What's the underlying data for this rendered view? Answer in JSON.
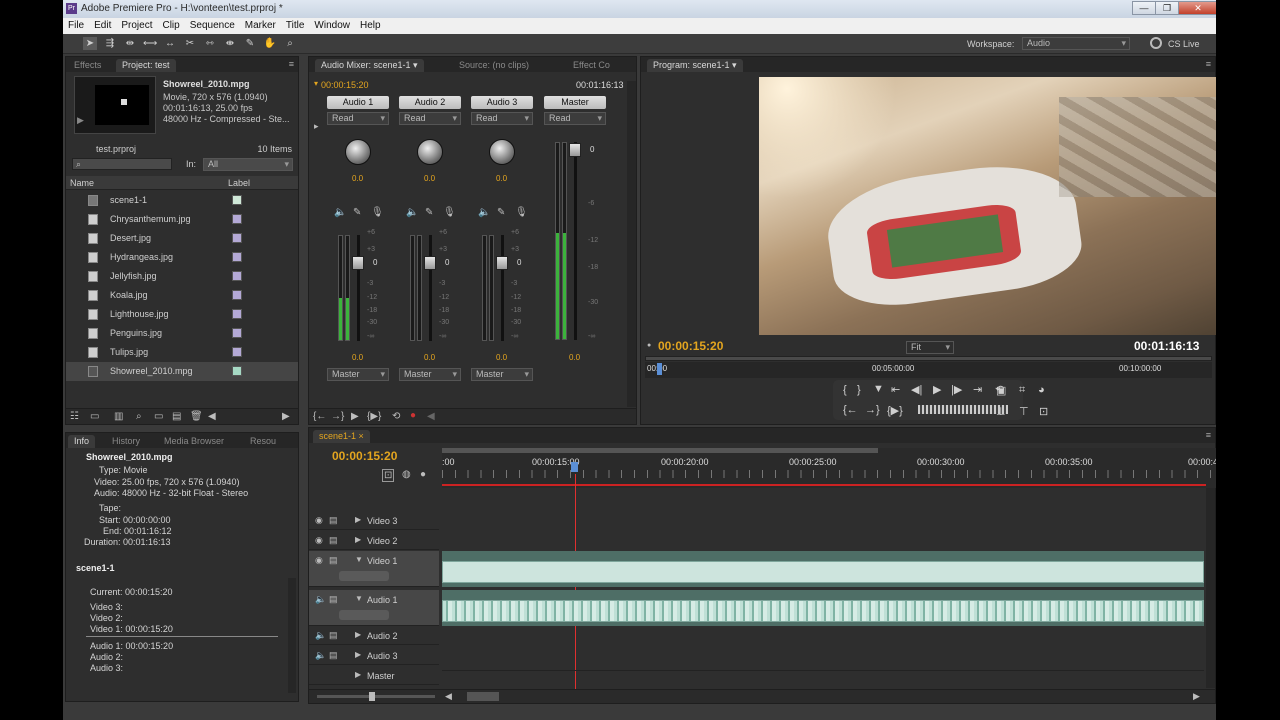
{
  "window": {
    "title": "Adobe Premiere Pro - H:\\vonteen\\test.prproj *",
    "min": "—",
    "max": "❐",
    "close": "✕"
  },
  "menu": [
    "File",
    "Edit",
    "Project",
    "Clip",
    "Sequence",
    "Marker",
    "Title",
    "Window",
    "Help"
  ],
  "workspace": {
    "label": "Workspace:",
    "value": "Audio",
    "cslive": "CS Live"
  },
  "project": {
    "tabs": [
      "Effects",
      "Project: test"
    ],
    "clip_name": "Showreel_2010.mpg",
    "clip_info": [
      "Movie, 720 x 576 (1.0940)",
      "00:01:16:13, 25.00 fps",
      "48000 Hz - Compressed - Ste..."
    ],
    "proj_name": "test.prproj",
    "item_count": "10 Items",
    "in_label": "In:",
    "in_value": "All",
    "col_name": "Name",
    "col_label": "Label",
    "items": [
      "scene1-1",
      "Chrysanthemum.jpg",
      "Desert.jpg",
      "Hydrangeas.jpg",
      "Jellyfish.jpg",
      "Koala.jpg",
      "Lighthouse.jpg",
      "Penguins.jpg",
      "Tulips.jpg",
      "Showreel_2010.mpg"
    ]
  },
  "mixer": {
    "tabs": [
      "Audio Mixer: scene1-1",
      "Source: (no clips)",
      "Effect Co"
    ],
    "time_left": "00:00:15:20",
    "time_right": "00:01:16:13",
    "channels": [
      "Audio 1",
      "Audio 2",
      "Audio 3",
      "Master"
    ],
    "mode": "Read",
    "knob_value": "0.0",
    "fader_value": "0.0",
    "fader_top": "0",
    "output": "Master",
    "scale": [
      "+6",
      "+3",
      "0",
      "-3",
      "-6",
      "-12",
      "-18",
      "-30",
      "-∞"
    ],
    "master_scale": [
      "0",
      "-6",
      "-12",
      "-18",
      "-30",
      "-∞"
    ]
  },
  "program": {
    "tab": "Program: scene1-1",
    "time": "00:00:15:20",
    "duration": "00:01:16:13",
    "fit": "Fit",
    "ruler": [
      "00:00",
      "00:05:00:00",
      "00:10:00:00"
    ]
  },
  "info": {
    "tabs": [
      "Info",
      "History",
      "Media Browser",
      "Resou"
    ],
    "clip": "Showreel_2010.mpg",
    "lines": [
      "Type: Movie",
      "Video: 25.00 fps, 720 x 576 (1.0940)",
      "Audio: 48000 Hz - 32-bit Float - Stereo",
      "",
      "Tape:",
      "Start: 00:00:00:00",
      "End: 00:01:16:12",
      "Duration: 00:01:16:13"
    ],
    "seq": "scene1-1",
    "seq_lines": [
      "Current: 00:00:15:20",
      "Video 3:",
      "Video 2:",
      "Video 1: 00:00:15:20"
    ],
    "audio_lines": [
      "Audio 1: 00:00:15:20",
      "Audio 2:",
      "Audio 3:"
    ]
  },
  "timeline": {
    "tab": "scene1-1",
    "time": "00:00:15:20",
    "ruler": [
      ":00",
      "00:00:15:00",
      "00:00:20:00",
      "00:00:25:00",
      "00:00:30:00",
      "00:00:35:00",
      "00:00:4"
    ],
    "tracks": [
      "Video 3",
      "Video 2",
      "Video 1",
      "Audio 1",
      "Audio 2",
      "Audio 3",
      "Master"
    ]
  }
}
